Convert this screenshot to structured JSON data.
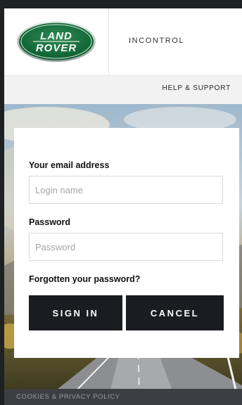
{
  "brand": {
    "logo_line1": "LAND",
    "logo_line2": "ROVER",
    "logo_color": "#0b5e2f",
    "app_name": "INCONTROL"
  },
  "nav": {
    "help_support": "HELP & SUPPORT"
  },
  "login": {
    "email_label": "Your email address",
    "email_placeholder": "Login name",
    "email_value": "",
    "password_label": "Password",
    "password_placeholder": "Password",
    "password_value": "",
    "forgot_password": "Forgotten your password?",
    "sign_in": "SIGN IN",
    "cancel": "CANCEL",
    "button_color": "#1a1c20"
  },
  "footer": {
    "cookies_privacy": "COOKIES & PRIVACY POLICY"
  }
}
